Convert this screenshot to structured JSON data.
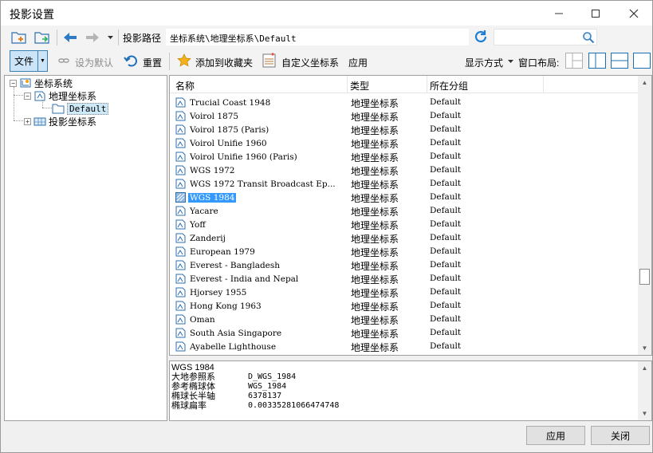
{
  "window": {
    "title": "投影设置"
  },
  "toolbar1": {
    "path_label": "投影路径",
    "path_value": "坐标系统\\地理坐标系\\Default",
    "search_placeholder": ""
  },
  "toolbar2": {
    "file_label": "文件",
    "set_default_label": "设为默认",
    "reset_label": "重置",
    "add_favorite_label": "添加到收藏夹",
    "custom_cs_label": "自定义坐标系",
    "apply_label": "应用",
    "display_mode_label": "显示方式",
    "window_layout_label": "窗口布局:"
  },
  "tree": {
    "root": "坐标系统",
    "geographic": "地理坐标系",
    "default": "Default",
    "projected": "投影坐标系"
  },
  "list": {
    "headers": [
      "名称",
      "类型",
      "所在分组"
    ],
    "rows": [
      {
        "name": "Trucial Coast 1948",
        "type": "地理坐标系",
        "group": "Default"
      },
      {
        "name": "Voirol 1875",
        "type": "地理坐标系",
        "group": "Default"
      },
      {
        "name": "Voirol 1875 (Paris)",
        "type": "地理坐标系",
        "group": "Default"
      },
      {
        "name": "Voirol Unifie 1960",
        "type": "地理坐标系",
        "group": "Default"
      },
      {
        "name": "Voirol Unifie 1960 (Paris)",
        "type": "地理坐标系",
        "group": "Default"
      },
      {
        "name": "WGS 1972",
        "type": "地理坐标系",
        "group": "Default"
      },
      {
        "name": "WGS 1972 Transit Broadcast Ep...",
        "type": "地理坐标系",
        "group": "Default"
      },
      {
        "name": "WGS 1984",
        "type": "地理坐标系",
        "group": "Default",
        "selected": true
      },
      {
        "name": "Yacare",
        "type": "地理坐标系",
        "group": "Default"
      },
      {
        "name": "Yoff",
        "type": "地理坐标系",
        "group": "Default"
      },
      {
        "name": "Zanderij",
        "type": "地理坐标系",
        "group": "Default"
      },
      {
        "name": "European 1979",
        "type": "地理坐标系",
        "group": "Default"
      },
      {
        "name": "Everest - Bangladesh",
        "type": "地理坐标系",
        "group": "Default"
      },
      {
        "name": "Everest - India and Nepal",
        "type": "地理坐标系",
        "group": "Default"
      },
      {
        "name": "Hjorsey 1955",
        "type": "地理坐标系",
        "group": "Default"
      },
      {
        "name": "Hong Kong 1963",
        "type": "地理坐标系",
        "group": "Default"
      },
      {
        "name": "Oman",
        "type": "地理坐标系",
        "group": "Default"
      },
      {
        "name": "South Asia Singapore",
        "type": "地理坐标系",
        "group": "Default"
      },
      {
        "name": "Ayabelle Lighthouse",
        "type": "地理坐标系",
        "group": "Default"
      }
    ]
  },
  "detail": {
    "title": "WGS 1984",
    "fields": [
      {
        "key": "大地参照系",
        "value": "D_WGS_1984"
      },
      {
        "key": "参考椭球体",
        "value": "WGS_1984"
      },
      {
        "key": "椭球长半轴",
        "value": "6378137"
      },
      {
        "key": "椭球扁率",
        "value": "0.00335281066474748"
      }
    ]
  },
  "footer": {
    "apply_label": "应用",
    "close_label": "关闭"
  },
  "colors": {
    "accent": "#1e6fb0",
    "selection": "#3399ff",
    "refresh": "#1a7fd4"
  }
}
